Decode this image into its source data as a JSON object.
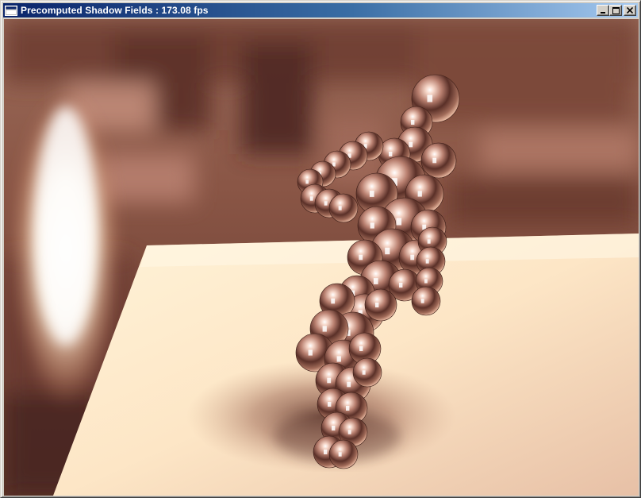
{
  "window": {
    "title": "Precomputed Shadow Fields : 173.08 fps",
    "icon": "application-window-icon",
    "buttons": {
      "minimize": "minimize-icon",
      "maximize": "maximize-icon",
      "close": "close-icon"
    }
  },
  "scene": {
    "description_icon": "3d-render-viewport",
    "colors": {
      "background_warm": "#8a5646",
      "background_dark": "#4a2a22",
      "floor_light": "#fde7c8",
      "floor_shade": "#c99a80",
      "light_glow": "#fff8ee",
      "sphere_base": "#b07a6a",
      "sphere_highlight": "#ffffff"
    }
  }
}
